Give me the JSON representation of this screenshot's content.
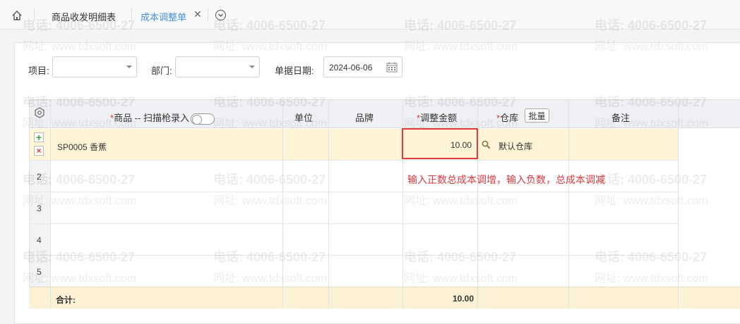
{
  "tabs": [
    {
      "label": "商品收发明细表",
      "active": false
    },
    {
      "label": "成本调整单",
      "active": true
    }
  ],
  "tab_close_glyph": "✕",
  "filters": {
    "project_label": "项目:",
    "project_value": "",
    "dept_label": "部门:",
    "dept_value": "",
    "date_label": "单据日期:",
    "date_value": "2024-06-06"
  },
  "grid": {
    "headers": {
      "product": "商品 -- 扫描枪录入",
      "unit": "单位",
      "brand": "品牌",
      "adjust_amount": "调整金额",
      "warehouse": "仓库",
      "batch": "批量",
      "remark": "备注"
    },
    "required_mark": "*",
    "rows": [
      {
        "num": "",
        "product": "SP0005 香蕉",
        "unit": "",
        "brand": "",
        "amount": "10.00",
        "warehouse": "默认仓库",
        "remark": ""
      },
      {
        "num": "2",
        "product": "",
        "unit": "",
        "brand": "",
        "amount": "",
        "warehouse": "",
        "remark": ""
      },
      {
        "num": "3",
        "product": "",
        "unit": "",
        "brand": "",
        "amount": "",
        "warehouse": "",
        "remark": ""
      },
      {
        "num": "4",
        "product": "",
        "unit": "",
        "brand": "",
        "amount": "",
        "warehouse": "",
        "remark": ""
      },
      {
        "num": "5",
        "product": "",
        "unit": "",
        "brand": "",
        "amount": "",
        "warehouse": "",
        "remark": ""
      }
    ],
    "total_label": "合计:",
    "total_amount": "10.00"
  },
  "annotation": "输入正数总成本调增，输入负数，总成本调减",
  "watermark": {
    "phone": "电话: 4006-6500-27",
    "site": "网址: www.tdxsoft.com"
  },
  "colors": {
    "accent": "#4a90d9",
    "highlight_row": "#fff5d6",
    "total_row": "#fdf1d5",
    "annotation_red": "#e0393e"
  }
}
